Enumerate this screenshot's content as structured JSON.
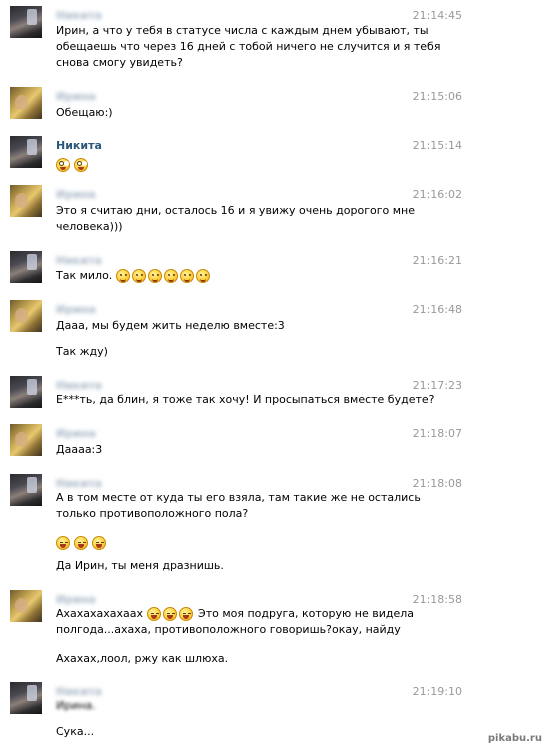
{
  "messages": [
    {
      "name": "Никита",
      "time": "21:14:45",
      "lines": [
        "Ирин, а что у тебя в статусе числа с каждым днем убывают, ты",
        "обещаешь что через 16 дней с тобой ничего не случится и я тебя",
        "снова смогу увидеть?"
      ]
    },
    {
      "name": "Ирина",
      "time": "21:15:06",
      "text": "Обещаю:)"
    },
    {
      "name": "Никита",
      "time": "21:15:14"
    },
    {
      "name": "Ирина",
      "time": "21:16:02",
      "lines": [
        "Это я считаю дни, осталось 16 и я увижу очень дорогого мне",
        "человека)))"
      ]
    },
    {
      "name": "Никита",
      "time": "21:16:21",
      "text": "Так мило."
    },
    {
      "name": "Ирина",
      "time": "21:16:48",
      "text": "Дааа, мы будем жить неделю вместе:3",
      "text2": "Так жду)"
    },
    {
      "name": "Никита",
      "time": "21:17:23",
      "text": "Е***ть, да блин, я тоже так хочу! И просыпаться вместе будете?"
    },
    {
      "name": "Ирина",
      "time": "21:18:07",
      "text": "Даааа:3"
    },
    {
      "name": "Никита",
      "time": "21:18:08",
      "lines": [
        "А в том месте от куда ты его взяла, там такие же не остались",
        "только противоположного пола?"
      ],
      "text3": "Да Ирин, ты меня дразнишь."
    },
    {
      "name": "Ирина",
      "time": "21:18:58",
      "text_a": "Ахахахахахаах",
      "text_b": "Это моя подруга, которую не видела",
      "text_c": "полгода...ахаха, противоположного говоришь?окау, найду",
      "text2": "Ахахах,лоол, ржу как шлюха."
    },
    {
      "name": "Никита",
      "time": "21:19:10",
      "text": "Ирина.",
      "text2": "Сука..."
    }
  ],
  "watermark": "pikabu.ru"
}
